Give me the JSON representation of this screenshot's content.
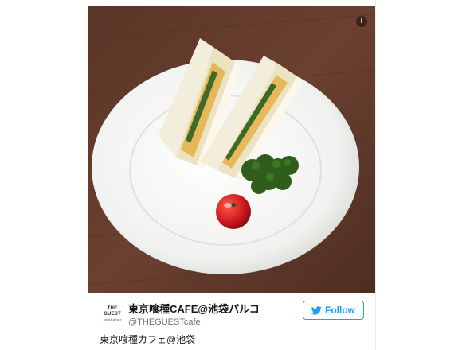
{
  "tweet": {
    "avatar_lines": [
      "THE",
      "GUEST",
      "cafe&diner"
    ],
    "display_name": "東京喰種CAFE@池袋パルコ",
    "handle": "@THEGUESTcafe",
    "follow_label": "Follow",
    "text": "東京喰種カフェ@池袋",
    "colors": {
      "accent": "#1da1f2",
      "name": "#14171a",
      "muted": "#657786"
    }
  },
  "media": {
    "info_icon": "info-icon",
    "glyph": "i"
  }
}
